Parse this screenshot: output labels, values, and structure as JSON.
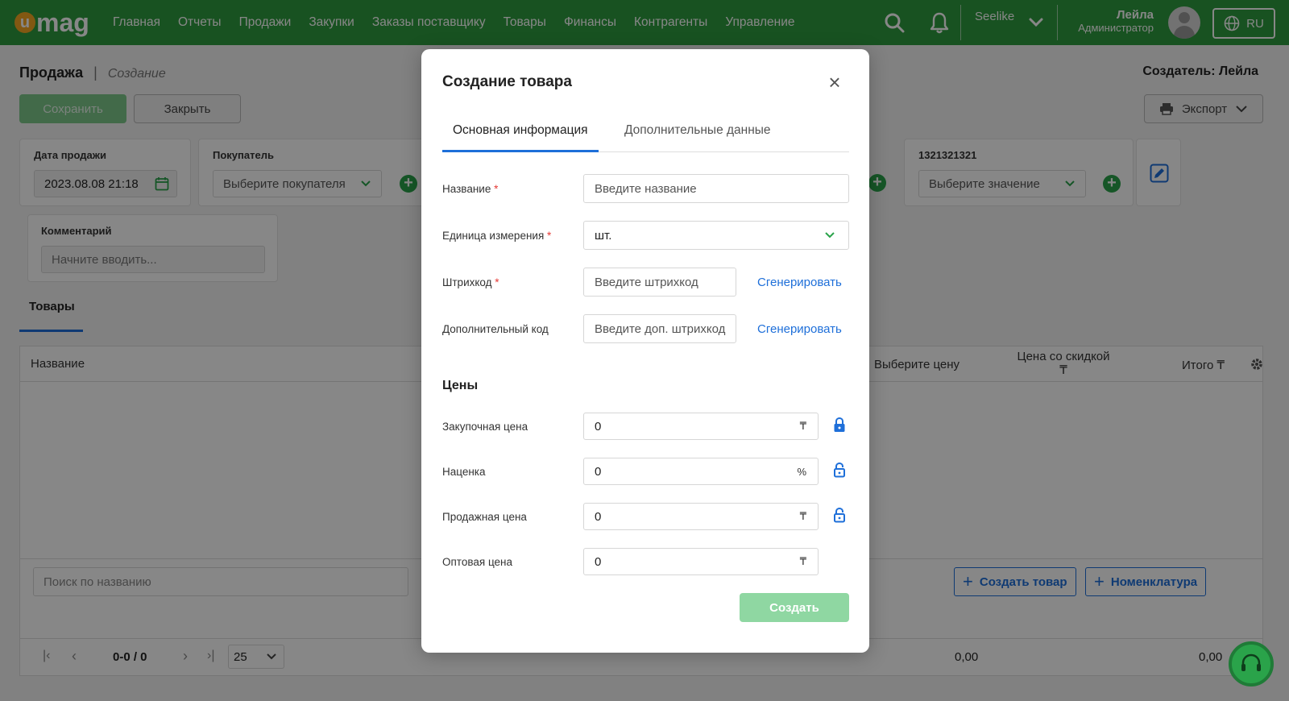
{
  "topbar": {
    "logo_u": "u",
    "logo_text": "mag",
    "nav": [
      "Главная",
      "Отчеты",
      "Продажи",
      "Закупки",
      "Заказы поставщику",
      "Товары",
      "Финансы",
      "Контрагенты",
      "Управление"
    ],
    "org": "Seelike",
    "user_name": "Лейла",
    "user_role": "Администратор",
    "lang": "RU",
    "brand_color": "#2e9b3f"
  },
  "page": {
    "breadcrumb_main": "Продажа",
    "breadcrumb_sep": "|",
    "breadcrumb_sub": "Создание",
    "creator": "Создатель: Лейла",
    "save_label": "Сохранить",
    "close_label": "Закрыть",
    "export_label": "Экспорт",
    "sale_date_label": "Дата продажи",
    "sale_date_value": "2023.08.08 21:18",
    "buyer_label": "Покупатель",
    "buyer_placeholder": "Выберите покупателя",
    "custom_field_label": "1321321321",
    "custom_field_placeholder": "Выберите значение",
    "comment_label": "Комментарий",
    "comment_placeholder": "Начните вводить...",
    "goods_tab": "Товары",
    "table": {
      "col_name": "Название",
      "col_select_price": "Выберите цену",
      "col_discount_price_1": "Цена со скидкой",
      "col_discount_price_2": "₸",
      "col_total": "Итого ₸",
      "search_placeholder": "Поиск по названию",
      "create_product": "Создать товар",
      "nomenclature": "Номенклатура",
      "pager_range": "0-0 / 0",
      "page_size": "25",
      "sum_1": "0,00",
      "sum_2": "0,00"
    }
  },
  "modal": {
    "title": "Создание товара",
    "tab_main": "Основная информация",
    "tab_extra": "Дополнительные данные",
    "name_label": "Название",
    "name_placeholder": "Введите название",
    "unit_label": "Единица измерения",
    "unit_value": "шт.",
    "barcode_label": "Штрихкод",
    "barcode_placeholder": "Введите штрихкод",
    "extra_code_label": "Дополнительный код",
    "extra_code_placeholder": "Введите доп. штрихкод",
    "generate": "Сгенерировать",
    "prices_heading": "Цены",
    "purchase_label": "Закупочная цена",
    "purchase_value": "0",
    "markup_label": "Наценка",
    "markup_value": "0",
    "sale_label": "Продажная цена",
    "sale_value": "0",
    "wholesale_label": "Оптовая цена",
    "wholesale_value": "0",
    "currency": "₸",
    "percent": "%",
    "required_mark": "*",
    "create_label": "Создать",
    "accent_color": "#1e6fd9"
  }
}
